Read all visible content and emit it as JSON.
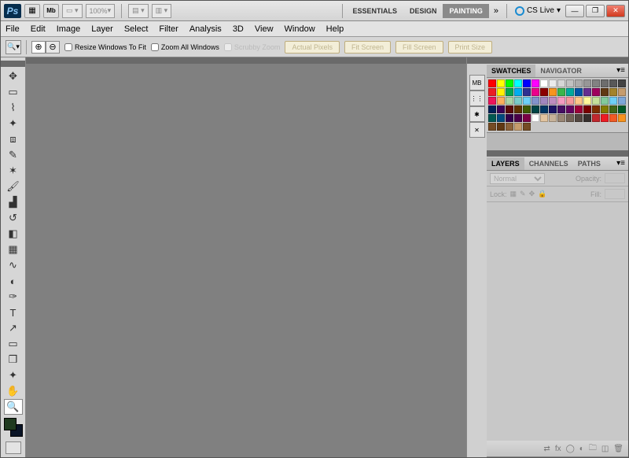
{
  "titlebar": {
    "logo": "Ps",
    "zoom_level": "100%",
    "workspaces": [
      "ESSENTIALS",
      "DESIGN",
      "PAINTING"
    ],
    "active_workspace": "PAINTING",
    "cs_live": "CS Live"
  },
  "menubar": [
    "File",
    "Edit",
    "Image",
    "Layer",
    "Select",
    "Filter",
    "Analysis",
    "3D",
    "View",
    "Window",
    "Help"
  ],
  "optionsbar": {
    "resize_label": "Resize Windows To Fit",
    "zoom_all_label": "Zoom All Windows",
    "scrubby_label": "Scrubby Zoom",
    "buttons": [
      "Actual Pixels",
      "Fit Screen",
      "Fill Screen",
      "Print Size"
    ]
  },
  "tools": [
    {
      "n": "move-tool",
      "g": "✥"
    },
    {
      "n": "marquee-tool",
      "g": "▭"
    },
    {
      "n": "lasso-tool",
      "g": "⌇"
    },
    {
      "n": "wand-tool",
      "g": "✦"
    },
    {
      "n": "crop-tool",
      "g": "⧈"
    },
    {
      "n": "eyedropper-tool",
      "g": "✎"
    },
    {
      "n": "healing-tool",
      "g": "✶"
    },
    {
      "n": "brush-tool",
      "g": "🖌"
    },
    {
      "n": "stamp-tool",
      "g": "▟"
    },
    {
      "n": "history-brush-tool",
      "g": "↺"
    },
    {
      "n": "eraser-tool",
      "g": "◧"
    },
    {
      "n": "gradient-tool",
      "g": "▦"
    },
    {
      "n": "blur-tool",
      "g": "∿"
    },
    {
      "n": "dodge-tool",
      "g": "◐"
    },
    {
      "n": "pen-tool",
      "g": "✑"
    },
    {
      "n": "type-tool",
      "g": "T"
    },
    {
      "n": "path-tool",
      "g": "↗"
    },
    {
      "n": "shape-tool",
      "g": "▭"
    },
    {
      "n": "3d-tool",
      "g": "❒"
    },
    {
      "n": "camera-tool",
      "g": "✦"
    },
    {
      "n": "hand-tool",
      "g": "✋"
    },
    {
      "n": "zoom-tool",
      "g": "🔍",
      "sel": true
    }
  ],
  "dock_icons": [
    {
      "n": "mini-bridge-icon",
      "g": "MB"
    },
    {
      "n": "brush-presets-icon",
      "g": "⋮⋮"
    },
    {
      "n": "brush-panel-icon",
      "g": "✱"
    },
    {
      "n": "tool-presets-icon",
      "g": "✕"
    }
  ],
  "panels": {
    "swatches": {
      "tabs": [
        "SWATCHES",
        "NAVIGATOR"
      ],
      "active": "SWATCHES"
    },
    "layers": {
      "tabs": [
        "LAYERS",
        "CHANNELS",
        "PATHS"
      ],
      "active": "LAYERS",
      "blend_mode": "Normal",
      "opacity_label": "Opacity:",
      "lock_label": "Lock:",
      "fill_label": "Fill:"
    }
  },
  "swatch_colors": [
    "#ff0000",
    "#ffff00",
    "#00ff00",
    "#00ffff",
    "#0000ff",
    "#ff00ff",
    "#ffffff",
    "#ebebeb",
    "#d6d6d6",
    "#c1c1c1",
    "#acacac",
    "#979797",
    "#828282",
    "#6d6d6d",
    "#585858",
    "#434343",
    "#ec1c24",
    "#fff200",
    "#00a651",
    "#00aeef",
    "#2e3192",
    "#ec008c",
    "#8b0000",
    "#f7941d",
    "#39b54a",
    "#00a99d",
    "#0054a6",
    "#652d90",
    "#9e005d",
    "#603913",
    "#a3832a",
    "#c69c6d",
    "#ed145b",
    "#fbaf5d",
    "#aad4a6",
    "#7accc8",
    "#6dcff6",
    "#8393ca",
    "#a186be",
    "#bd8cbf",
    "#f49ac1",
    "#f5989d",
    "#fdc689",
    "#fff799",
    "#c4df9b",
    "#82ca9c",
    "#6ecff6",
    "#7da7d9",
    "#002157",
    "#3a0256",
    "#5b0a0a",
    "#5e3200",
    "#3e5902",
    "#004445",
    "#003663",
    "#1b1464",
    "#440e62",
    "#630460",
    "#9e0039",
    "#790000",
    "#7b2e00",
    "#827b00",
    "#406618",
    "#005826",
    "#005952",
    "#004a80",
    "#32004b",
    "#4b0049",
    "#7b0046",
    "#ffffff",
    "#e2c49f",
    "#c7b299",
    "#998675",
    "#736357",
    "#534741",
    "#362f2d",
    "#c1272d",
    "#ed1c24",
    "#f15a24",
    "#f7931e",
    "#754c24",
    "#603813",
    "#8c6239",
    "#c69c6d",
    "#754c24"
  ]
}
